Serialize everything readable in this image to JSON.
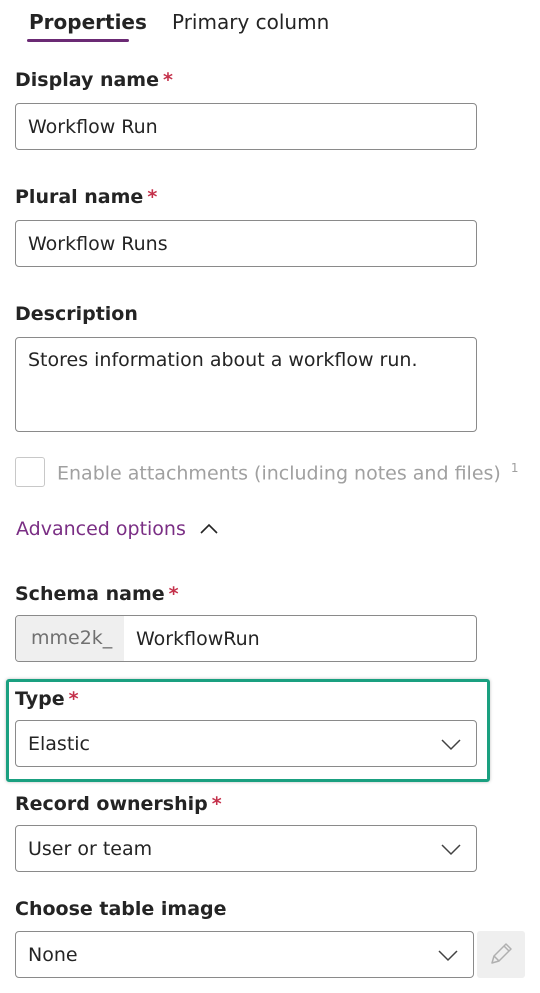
{
  "tabs": [
    {
      "label": "Properties",
      "selected": true
    },
    {
      "label": "Primary column",
      "selected": false
    }
  ],
  "display_name": {
    "label": "Display name",
    "required": "*",
    "value": "Workflow Run"
  },
  "plural_name": {
    "label": "Plural name",
    "required": "*",
    "value": "Workflow Runs"
  },
  "description": {
    "label": "Description",
    "value": "Stores information about a workflow run."
  },
  "attachments": {
    "label": "Enable attachments (including notes and files)",
    "footnote": "1",
    "checked": false,
    "disabled": true
  },
  "advanced": {
    "label": "Advanced options",
    "expanded": true
  },
  "schema_name": {
    "label": "Schema name",
    "required": "*",
    "prefix": "mme2k_",
    "value": "WorkflowRun"
  },
  "type": {
    "label": "Type",
    "required": "*",
    "value": "Elastic"
  },
  "ownership": {
    "label": "Record ownership",
    "required": "*",
    "value": "User or team"
  },
  "table_image": {
    "label": "Choose table image",
    "value": "None"
  },
  "colors": {
    "accent": "#6b2a74",
    "link": "#7a2e84",
    "required": "#c4314b",
    "highlight": "#1aa080"
  },
  "icons": {
    "chevron": "chevron-down-icon",
    "collapse": "chevron-up-icon",
    "edit": "pencil-icon"
  }
}
